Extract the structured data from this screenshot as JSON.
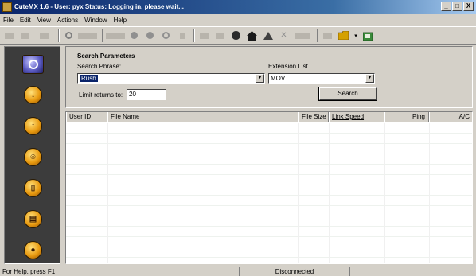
{
  "window": {
    "title": "CuteMX 1.6 - User: pyx  Status: Logging in, please wait...",
    "minimize": "_",
    "maximize": "□",
    "close": "X"
  },
  "menu": [
    "File",
    "Edit",
    "View",
    "Actions",
    "Window",
    "Help"
  ],
  "toolbar": {
    "icons": [
      "back-icon",
      "forward-icon",
      "stop-icon",
      "refresh-icon",
      "disconnect-icon",
      "record-icon",
      "stop-record-icon",
      "settings-icon",
      "play-icon",
      "skip-icon",
      "globe-icon",
      "home-icon",
      "up-icon",
      "delete-icon",
      "view-icon",
      "folder-icon",
      "dropdown-icon",
      "download-icon"
    ],
    "accent_colors": {
      "globe": "#2a2a2a",
      "home": "#1a1a1a",
      "folder": "#d4a000",
      "download": "#2a7a2a"
    }
  },
  "sidebar": {
    "buttons": [
      {
        "name": "search",
        "glyph": ""
      },
      {
        "name": "download",
        "glyph": "↓"
      },
      {
        "name": "upload",
        "glyph": "↑"
      },
      {
        "name": "users",
        "glyph": "☺"
      },
      {
        "name": "library",
        "glyph": "▯"
      },
      {
        "name": "chat",
        "glyph": "▤"
      },
      {
        "name": "settings",
        "glyph": "●"
      }
    ]
  },
  "search_params": {
    "title": "Search Parameters",
    "phrase_label": "Search Phrase:",
    "phrase_value": "Rush",
    "extension_label": "Extension List",
    "extension_value": "MOV",
    "limit_label": "Limit returns to:",
    "limit_value": "20",
    "search_button": "Search"
  },
  "results": {
    "columns": [
      "User ID",
      "File Name",
      "File Size",
      "Link Speed",
      "Ping",
      "A/C"
    ]
  },
  "status": {
    "help": "For Help, press F1",
    "connection": "Disconnected"
  }
}
